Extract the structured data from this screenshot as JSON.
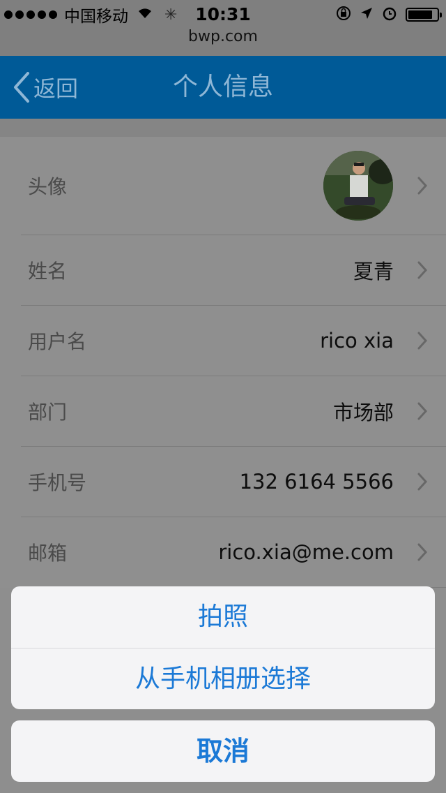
{
  "status_bar": {
    "carrier": "中国移动",
    "time": "10:31",
    "url": "bwp.com"
  },
  "nav": {
    "back_label": "返回",
    "title": "个人信息"
  },
  "profile": {
    "avatar_label": "头像",
    "rows": [
      {
        "label": "姓名",
        "value": "夏青"
      },
      {
        "label": "用户名",
        "value": "rico xia"
      },
      {
        "label": "部门",
        "value": "市场部"
      },
      {
        "label": "手机号",
        "value": "132 6164 5566"
      },
      {
        "label": "邮箱",
        "value": "rico.xia@me.com"
      }
    ]
  },
  "action_sheet": {
    "options": [
      "拍照",
      "从手机相册选择"
    ],
    "cancel": "取消"
  },
  "colors": {
    "nav_bar": "#005a97",
    "action_text": "#1b79d6",
    "sheet_bg": "#f4f4f6"
  }
}
